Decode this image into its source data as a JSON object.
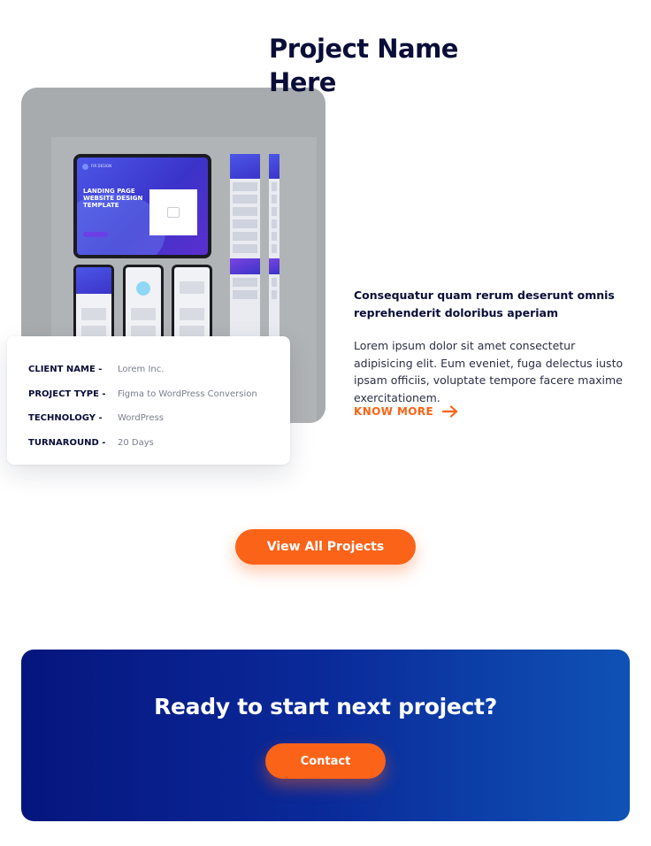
{
  "project": {
    "title": "Project Name Here",
    "mockup": {
      "tablet_brand": "FIR DESIGN",
      "tablet_headline": "LANDING PAGE WEBSITE DESIGN TEMPLATE"
    },
    "details": [
      {
        "label": "CLIENT NAME -",
        "value": "Lorem Inc."
      },
      {
        "label": "PROJECT TYPE -",
        "value": "Figma to WordPress Conversion"
      },
      {
        "label": "TECHNOLOGY -",
        "value": "WordPress"
      },
      {
        "label": "TURNAROUND -",
        "value": "20 Days"
      }
    ],
    "subtitle": "Consequatur quam rerum deserunt omnis reprehenderit doloribus aperiam",
    "description": "Lorem ipsum dolor sit amet consectetur adipisicing elit. Eum eveniet, fuga delectus iusto ipsam officiis, voluptate tempore facere maxime exercitationem.",
    "know_more_label": "KNOW MORE"
  },
  "view_all_label": "View All Projects",
  "cta": {
    "title": "Ready to start next project?",
    "button_label": "Contact"
  },
  "colors": {
    "accent": "#fb6319",
    "navy": "#0a0d38",
    "cta_gradient_start": "#06157e",
    "cta_gradient_end": "#0f52b5"
  },
  "icons": {
    "know_more": "arrow-right-icon"
  }
}
